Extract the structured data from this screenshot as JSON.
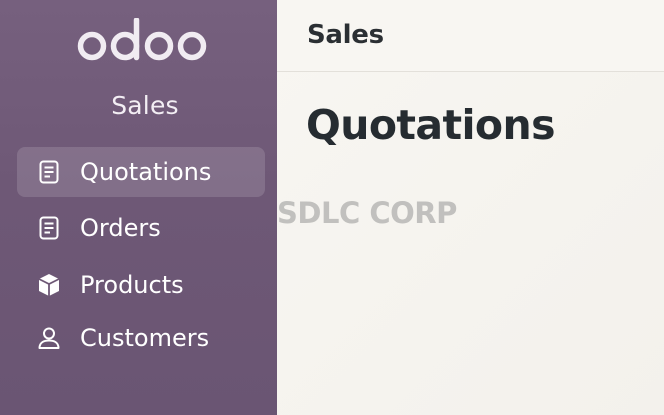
{
  "sidebar": {
    "logo_text": "odoo",
    "app_name": "Sales",
    "items": [
      {
        "label": "Quotations",
        "icon": "document-icon",
        "active": true
      },
      {
        "label": "Orders",
        "icon": "document-icon",
        "active": false
      },
      {
        "label": "Products",
        "icon": "box-icon",
        "active": false
      },
      {
        "label": "Customers",
        "icon": "user-icon",
        "active": false
      }
    ]
  },
  "header": {
    "breadcrumb": "Sales"
  },
  "main": {
    "title": "Quotations"
  },
  "watermark": "SDLC CORP",
  "colors": {
    "sidebar": "#6e5876",
    "active_item": "#8a7792",
    "content_bg": "#f6f4f0",
    "title_text": "#262c31"
  }
}
